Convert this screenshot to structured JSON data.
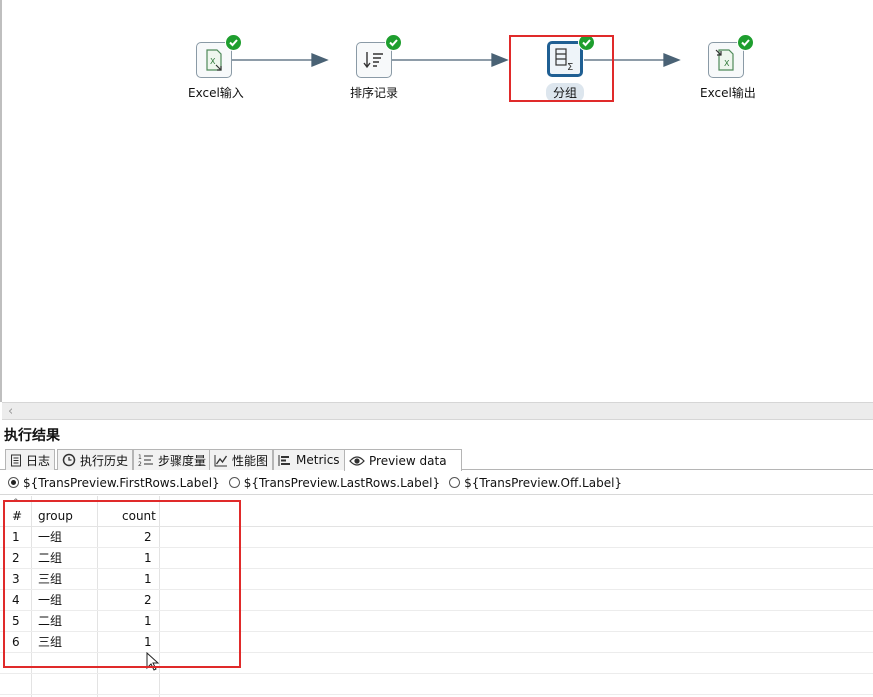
{
  "canvas": {
    "steps": [
      {
        "label": "Excel输入",
        "icon": "excel-input-icon"
      },
      {
        "label": "排序记录",
        "icon": "sort-rows-icon"
      },
      {
        "label": "分组",
        "icon": "group-by-icon"
      },
      {
        "label": "Excel输出",
        "icon": "excel-output-icon"
      }
    ]
  },
  "results": {
    "title": "执行结果",
    "tabs": [
      {
        "label": "日志"
      },
      {
        "label": "执行历史"
      },
      {
        "label": "步骤度量"
      },
      {
        "label": "性能图"
      },
      {
        "label": "Metrics"
      },
      {
        "label": "Preview data"
      }
    ],
    "radios": [
      {
        "label": "${TransPreview.FirstRows.Label}"
      },
      {
        "label": "${TransPreview.LastRows.Label}"
      },
      {
        "label": "${TransPreview.Off.Label}"
      }
    ],
    "grid": {
      "headers": {
        "num": "#",
        "group": "group",
        "count": "count"
      },
      "rows": [
        {
          "num": "1",
          "group": "一组",
          "count": "2"
        },
        {
          "num": "2",
          "group": "二组",
          "count": "1"
        },
        {
          "num": "3",
          "group": "三组",
          "count": "1"
        },
        {
          "num": "4",
          "group": "一组",
          "count": "2"
        },
        {
          "num": "5",
          "group": "二组",
          "count": "1"
        },
        {
          "num": "6",
          "group": "三组",
          "count": "1"
        }
      ]
    }
  },
  "colors": {
    "accent": "#1f5f93",
    "ok": "#1e9e2e",
    "highlight": "#e02a2a"
  }
}
